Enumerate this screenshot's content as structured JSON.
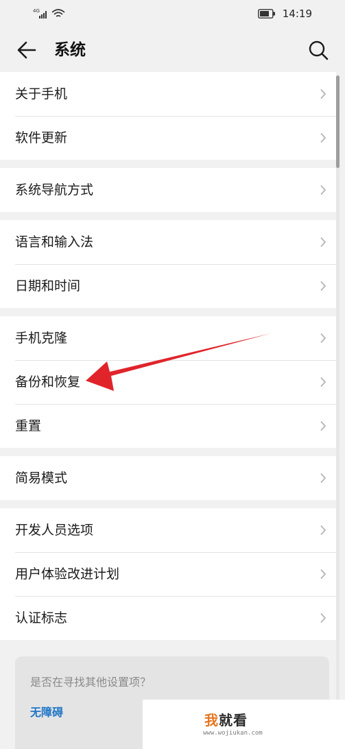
{
  "status_bar": {
    "network": "4G",
    "time": "14:19"
  },
  "header": {
    "title": "系统"
  },
  "groups": [
    {
      "items": [
        {
          "label": "关于手机"
        },
        {
          "label": "软件更新"
        }
      ]
    },
    {
      "items": [
        {
          "label": "系统导航方式"
        }
      ]
    },
    {
      "items": [
        {
          "label": "语言和输入法"
        },
        {
          "label": "日期和时间"
        }
      ]
    },
    {
      "items": [
        {
          "label": "手机克隆"
        },
        {
          "label": "备份和恢复"
        },
        {
          "label": "重置"
        }
      ]
    },
    {
      "items": [
        {
          "label": "简易模式"
        }
      ]
    },
    {
      "items": [
        {
          "label": "开发人员选项"
        },
        {
          "label": "用户体验改进计划"
        },
        {
          "label": "认证标志"
        }
      ]
    }
  ],
  "suggestion": {
    "question": "是否在寻找其他设置项？",
    "link": "无障碍"
  },
  "watermark": {
    "first_char": "我",
    "rest": "就看",
    "url": "www.wojiukan.com"
  },
  "annotation": {
    "arrow_color": "#e0242a"
  },
  "colors": {
    "background": "#f1f1f1",
    "card": "#ffffff",
    "link": "#1f76c7"
  }
}
